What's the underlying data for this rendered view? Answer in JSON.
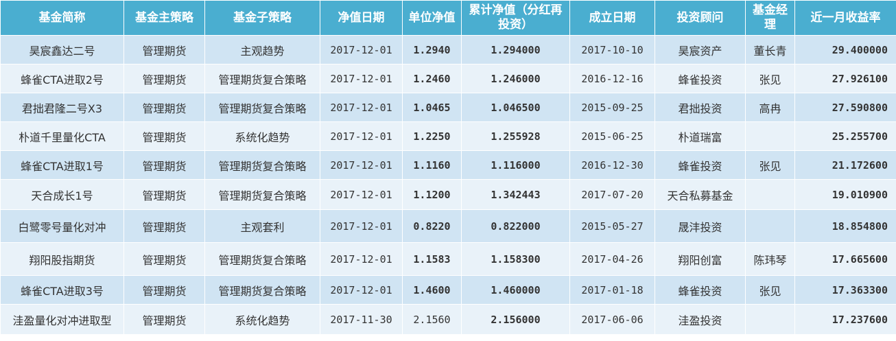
{
  "table": {
    "headers": [
      "基金简称",
      "基金主策略",
      "基金子策略",
      "净值日期",
      "单位净值",
      "累计净值（分红再投资）",
      "成立日期",
      "投资顾问",
      "基金经理",
      "近一月收益率"
    ],
    "rows": [
      [
        "昊宸鑫达二号",
        "管理期货",
        "主观趋势",
        "2017-12-01",
        "1.2940",
        "1.294000",
        "2017-10-10",
        "昊宸资产",
        "董长青",
        "29.400000"
      ],
      [
        "蜂雀CTA进取2号",
        "管理期货",
        "管理期货复合策略",
        "2017-12-01",
        "1.2460",
        "1.246000",
        "2016-12-16",
        "蜂雀投资",
        "张见",
        "27.926100"
      ],
      [
        "君拙君隆二号X3",
        "管理期货",
        "管理期货复合策略",
        "2017-12-01",
        "1.0465",
        "1.046500",
        "2015-09-25",
        "君拙投资",
        "高冉",
        "27.590800"
      ],
      [
        "朴道千里量化CTA",
        "管理期货",
        "系统化趋势",
        "2017-12-01",
        "1.2250",
        "1.255928",
        "2015-06-25",
        "朴道瑞富",
        "",
        "25.255700"
      ],
      [
        "蜂雀CTA进取1号",
        "管理期货",
        "管理期货复合策略",
        "2017-12-01",
        "1.1160",
        "1.116000",
        "2016-12-30",
        "蜂雀投资",
        "张见",
        "21.172600"
      ],
      [
        "天合成长1号",
        "管理期货",
        "管理期货复合策略",
        "2017-12-01",
        "1.1200",
        "1.342443",
        "2017-07-20",
        "天合私募基金",
        "",
        "19.010900"
      ],
      [
        "白鹭零号量化对冲",
        "管理期货",
        "主观套利",
        "2017-12-01",
        "0.8220",
        "0.822000",
        "2015-05-27",
        "晟沣投资",
        "",
        "18.854800"
      ],
      [
        "翔阳股指期货",
        "管理期货",
        "管理期货复合策略",
        "2017-12-01",
        "1.1583",
        "1.158300",
        "2017-04-26",
        "翔阳创富",
        "陈玮琴",
        "17.665600"
      ],
      [
        "蜂雀CTA进取3号",
        "管理期货",
        "管理期货复合策略",
        "2017-12-01",
        "1.4600",
        "1.460000",
        "2017-01-18",
        "蜂雀投资",
        "张见",
        "17.363300"
      ],
      [
        "洼盈量化对冲进取型",
        "管理期货",
        "系统化趋势",
        "2017-11-30",
        "2.1560",
        "2.156000",
        "2017-06-06",
        "洼盈投资",
        "",
        "17.237600"
      ]
    ]
  },
  "colors": {
    "header_bg": "#4aaed0",
    "row_a_bg": "#d0e4f3",
    "row_b_bg": "#e9f2f9"
  }
}
